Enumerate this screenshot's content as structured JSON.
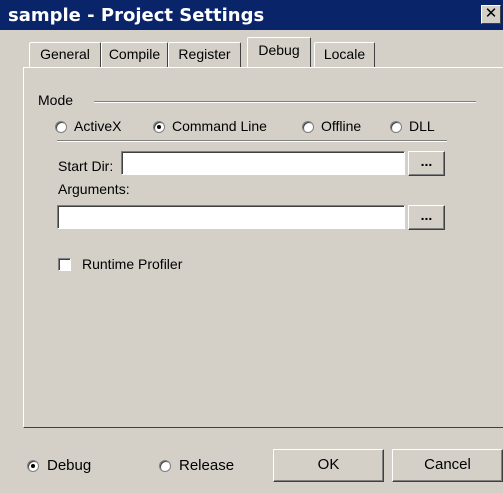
{
  "window": {
    "title": "sample - Project Settings",
    "close_glyph": "✕"
  },
  "tabs": [
    {
      "label": "General",
      "active": false
    },
    {
      "label": "Compile",
      "active": false
    },
    {
      "label": "Register",
      "active": false
    },
    {
      "label": "Debug",
      "active": true
    },
    {
      "label": "Locale",
      "active": false
    }
  ],
  "debug": {
    "mode_label": "Mode",
    "modes": [
      {
        "label": "ActiveX",
        "selected": false
      },
      {
        "label": "Command Line",
        "selected": true
      },
      {
        "label": "Offline",
        "selected": false
      },
      {
        "label": "DLL",
        "selected": false
      }
    ],
    "start_dir_label": "Start Dir:",
    "start_dir_value": "",
    "arguments_label": "Arguments:",
    "arguments_value": "",
    "browse_label": "...",
    "runtime_profiler_label": "Runtime Profiler",
    "runtime_profiler_checked": false
  },
  "footer": {
    "configs": [
      {
        "label": "Debug",
        "selected": true
      },
      {
        "label": "Release",
        "selected": false
      }
    ],
    "ok_label": "OK",
    "cancel_label": "Cancel"
  }
}
